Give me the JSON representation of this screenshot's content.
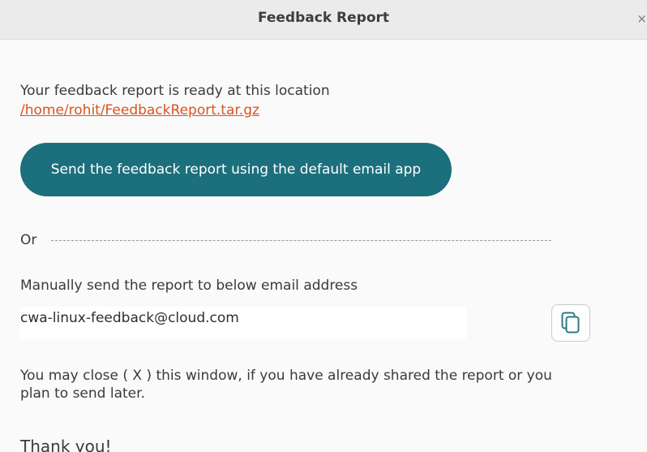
{
  "window": {
    "title": "Feedback Report",
    "close_glyph": "×"
  },
  "report": {
    "ready_text": "Your feedback report is ready at this location",
    "path": "/home/rohit/FeedbackReport.tar.gz"
  },
  "send_button": {
    "label": "Send the feedback report using the default email app"
  },
  "divider": {
    "or_label": "Or"
  },
  "manual": {
    "instruction": "Manually send the report to below email address",
    "email": "cwa-linux-feedback@cloud.com",
    "copy_icon": "copy-icon"
  },
  "footer": {
    "close_note": "You may close ( X ) this window, if you have already shared the report or you plan to send later.",
    "thanks": "Thank you!"
  },
  "colors": {
    "accent": "#1c6f7c",
    "link": "#d9531e"
  }
}
